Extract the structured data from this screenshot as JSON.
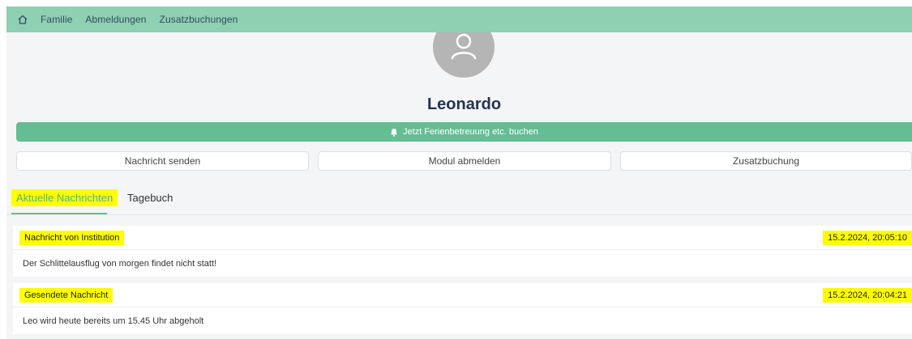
{
  "nav": {
    "home_icon": "home-icon",
    "links": [
      "Familie",
      "Abmeldungen",
      "Zusatzbuchungen"
    ]
  },
  "profile": {
    "avatar_icon": "user-icon",
    "name": "Leonardo"
  },
  "booking": {
    "icon": "bell-icon",
    "label": "Jetzt Ferienbetreuung etc. buchen"
  },
  "actions": {
    "send_message": "Nachricht senden",
    "unsubscribe_module": "Modul abmelden",
    "extra_booking": "Zusatzbuchung"
  },
  "tabs": {
    "current_messages": "Aktuelle Nachrichten",
    "diary": "Tagebuch"
  },
  "messages": [
    {
      "title": "Nachricht von Institution",
      "timestamp": "15.2.2024, 20:05:10",
      "text": "Der Schlittelausflug von morgen findet nicht statt!"
    },
    {
      "title": "Gesendete Nachricht",
      "timestamp": "15.2.2024, 20:04:21",
      "text": "Leo wird heute bereits um 15.45 Uhr abgeholt"
    }
  ],
  "colors": {
    "nav": "#8fcfb2",
    "accent": "#65bd93",
    "highlight": "#ffff00",
    "name": "#22344f"
  }
}
